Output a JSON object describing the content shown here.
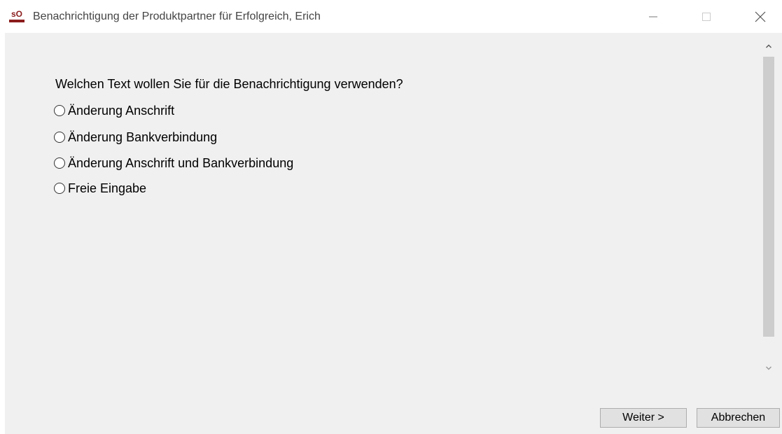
{
  "window": {
    "title": "Benachrichtigung der Produktpartner für Erfolgreich, Erich",
    "icon": "so-app-icon",
    "icon_text": "sO",
    "icon_color": "#8b1c1c"
  },
  "dialog": {
    "question": "Welchen Text wollen Sie für die Benachrichtigung verwenden?",
    "options": [
      {
        "label": "Änderung Anschrift",
        "selected": false
      },
      {
        "label": "Änderung Bankverbindung",
        "selected": false
      },
      {
        "label": "Änderung Anschrift und Bankverbindung",
        "selected": false
      },
      {
        "label": "Freie Eingabe",
        "selected": false
      }
    ]
  },
  "buttons": {
    "next_label": "Weiter >",
    "cancel_label": "Abbrechen"
  },
  "colors": {
    "content_background": "#f0f0f0",
    "scroll_thumb": "#cdcdcd",
    "button_background": "#e1e1e1"
  }
}
